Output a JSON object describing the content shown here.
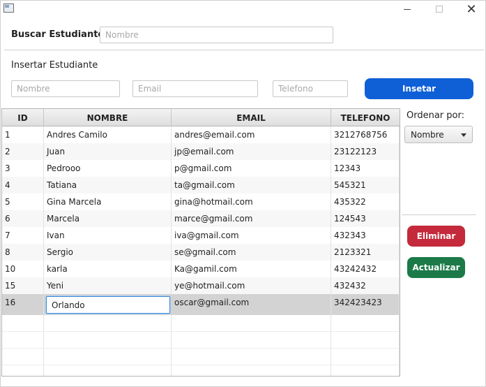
{
  "window": {
    "icon": "app-window-icon",
    "controls": {
      "minimize": "",
      "maximize": "",
      "close": "✕"
    }
  },
  "search": {
    "label": "Buscar Estudiante",
    "placeholder": "Nombre",
    "value": ""
  },
  "insert": {
    "label": "Insertar Estudiante",
    "name_placeholder": "Nombre",
    "email_placeholder": "Email",
    "phone_placeholder": "Telefono",
    "button_label": "Insetar"
  },
  "table": {
    "columns": [
      "ID",
      "NOMBRE",
      "EMAIL",
      "TELEFONO"
    ],
    "rows": [
      {
        "id": "1",
        "nombre": "Andres Camilo",
        "email": "andres@email.com",
        "telefono": "3212768756"
      },
      {
        "id": "2",
        "nombre": "Juan",
        "email": "jp@email.com",
        "telefono": "23122123"
      },
      {
        "id": "3",
        "nombre": "Pedrooo",
        "email": "p@gmail.com",
        "telefono": "12343"
      },
      {
        "id": "4",
        "nombre": "Tatiana",
        "email": "ta@gmail.com",
        "telefono": "545321"
      },
      {
        "id": "5",
        "nombre": "Gina Marcela",
        "email": "gina@hotmail.com",
        "telefono": "435322"
      },
      {
        "id": "6",
        "nombre": "Marcela",
        "email": "marce@gmail.com",
        "telefono": "124543"
      },
      {
        "id": "7",
        "nombre": "Ivan",
        "email": "iva@gmail.com",
        "telefono": "432343"
      },
      {
        "id": "8",
        "nombre": "Sergio",
        "email": "se@gmail.com",
        "telefono": "2123321"
      },
      {
        "id": "10",
        "nombre": "karla",
        "email": "Ka@gamil.com",
        "telefono": "43242432"
      },
      {
        "id": "15",
        "nombre": "Yeni",
        "email": "ye@hotmail.com",
        "telefono": "432432"
      }
    ],
    "selected_row": {
      "id": "16",
      "nombre": "Orlando",
      "email": "oscar@gmail.com",
      "telefono": "342423423"
    }
  },
  "sidebar": {
    "order_label": "Ordenar por:",
    "order_value": "Nombre",
    "delete_label": "Eliminar",
    "update_label": "Actualizar"
  },
  "colors": {
    "insert_button": "#0f5fd7",
    "delete_button": "#c42a3b",
    "update_button": "#1b7a48",
    "selected_row": "#d3d3d3"
  }
}
